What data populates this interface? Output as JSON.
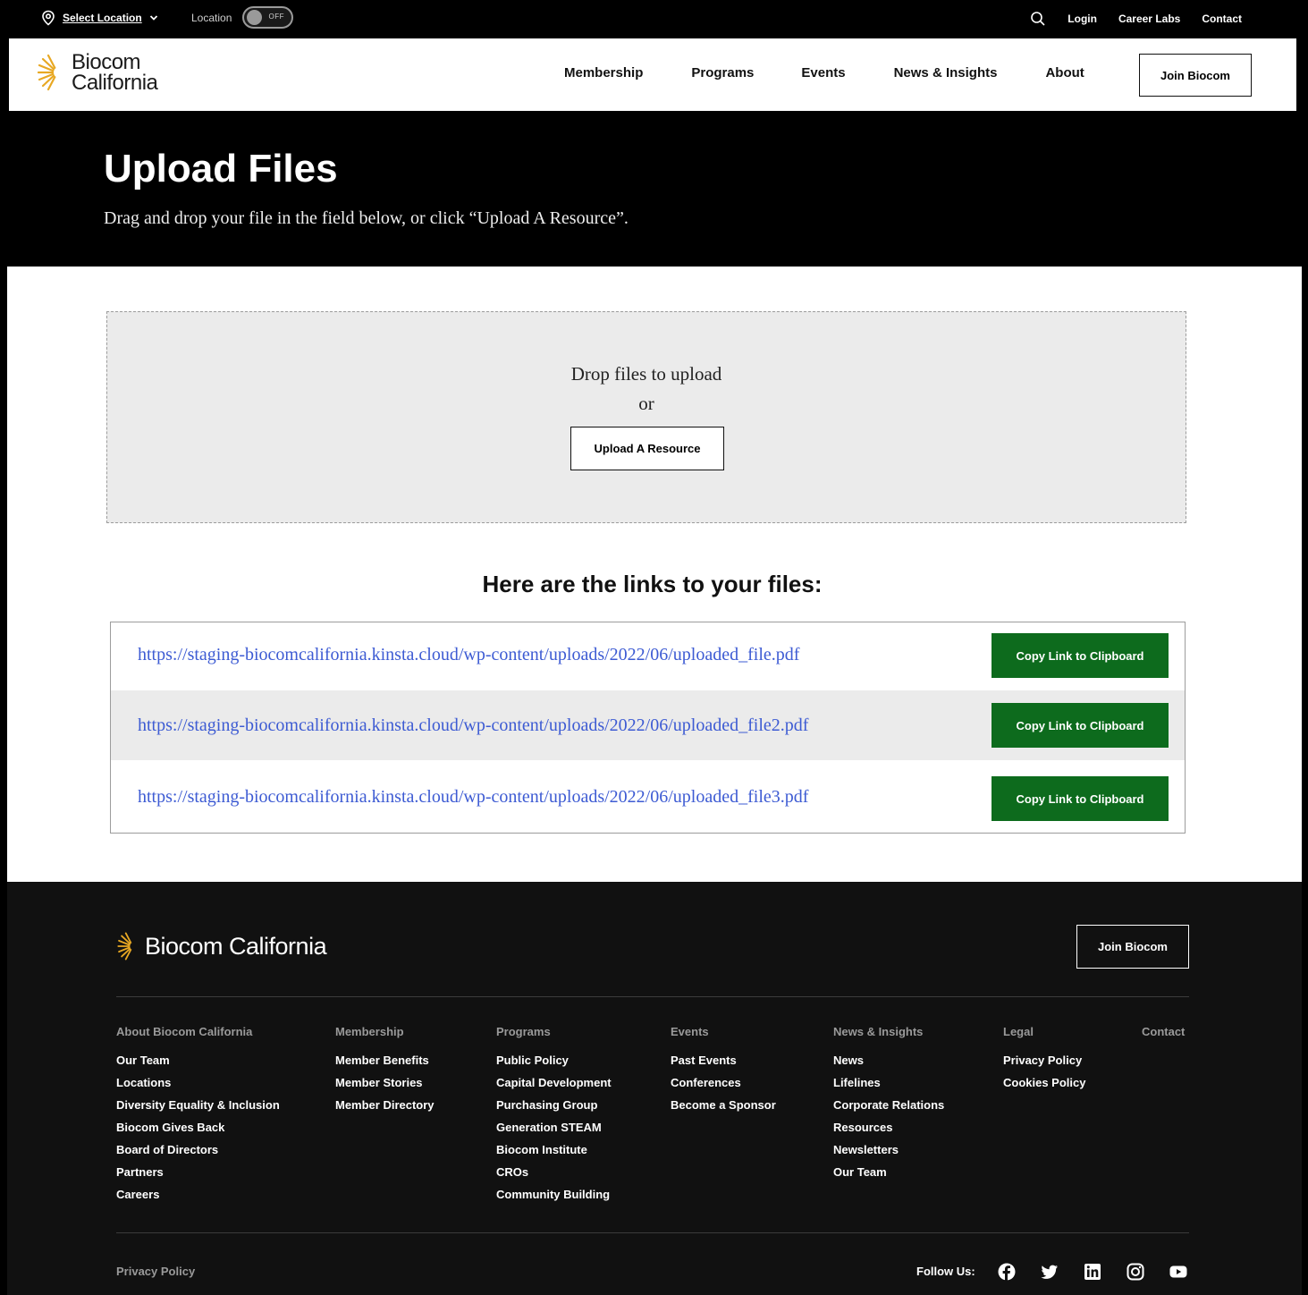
{
  "utility": {
    "location_link": "Select Location",
    "location_label": "Location",
    "toggle_state": "OFF",
    "links": [
      "Login",
      "Career Labs",
      "Contact"
    ]
  },
  "header": {
    "logo_line1": "Biocom",
    "logo_line2": "California",
    "nav": [
      "Membership",
      "Programs",
      "Events",
      "News & Insights",
      "About"
    ],
    "join_button": "Join Biocom"
  },
  "hero": {
    "title": "Upload Files",
    "subtitle": "Drag and drop your file in the field below, or click “Upload A Resource”."
  },
  "dropzone": {
    "drop_text": "Drop files to upload",
    "or_text": "or",
    "upload_button": "Upload A Resource"
  },
  "links": {
    "title": "Here are the links to your files:",
    "rows": [
      {
        "url": "https://staging-biocomcalifornia.kinsta.cloud/wp-content/uploads/2022/06/uploaded_file.pdf",
        "button": "Copy Link to Clipboard"
      },
      {
        "url": "https://staging-biocomcalifornia.kinsta.cloud/wp-content/uploads/2022/06/uploaded_file2.pdf",
        "button": "Copy Link to Clipboard"
      },
      {
        "url": "https://staging-biocomcalifornia.kinsta.cloud/wp-content/uploads/2022/06/uploaded_file3.pdf",
        "button": "Copy Link to Clipboard"
      }
    ]
  },
  "footer": {
    "logo": "Biocom California",
    "join_button": "Join Biocom",
    "columns": [
      {
        "heading": "About Biocom California",
        "items": [
          "Our Team",
          "Locations",
          "Diversity Equality & Inclusion",
          "Biocom Gives Back",
          "Board of Directors",
          "Partners",
          "Careers"
        ]
      },
      {
        "heading": "Membership",
        "items": [
          "Member Benefits",
          "Member Stories",
          "Member Directory"
        ]
      },
      {
        "heading": "Programs",
        "items": [
          "Public Policy",
          "Capital Development",
          "Purchasing Group",
          "Generation STEAM",
          "Biocom Institute",
          "CROs",
          "Community Building"
        ]
      },
      {
        "heading": "Events",
        "items": [
          "Past Events",
          "Conferences",
          "Become a Sponsor"
        ]
      },
      {
        "heading": "News & Insights",
        "items": [
          "News",
          "Lifelines",
          "Corporate Relations",
          "Resources",
          "Newsletters",
          "Our Team"
        ]
      },
      {
        "heading": "Legal",
        "items": [
          "Privacy Policy",
          "Cookies Policy"
        ]
      },
      {
        "heading": "Contact",
        "items": []
      }
    ],
    "bottom_link": "Privacy Policy",
    "follow_label": "Follow Us:",
    "social_icons": [
      "facebook-icon",
      "twitter-icon",
      "linkedin-icon",
      "instagram-icon",
      "youtube-icon"
    ]
  },
  "colors": {
    "brand_green": "#0d6b1d",
    "link_blue": "#3d5bd3",
    "logo_gold": "#e8a823"
  }
}
